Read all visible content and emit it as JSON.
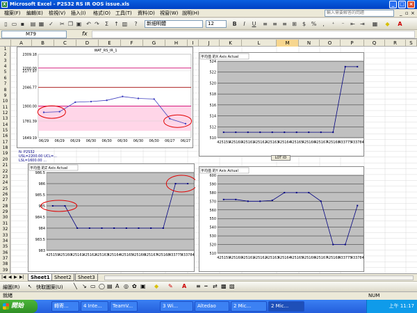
{
  "window": {
    "title": "Microsoft Excel - P2S32 RS IR OOS issue.xls"
  },
  "menu": {
    "items": [
      "檔案(F)",
      "編輯(E)",
      "檢視(V)",
      "插入(I)",
      "格式(O)",
      "工具(T)",
      "資料(D)",
      "視窗(W)",
      "說明(H)"
    ],
    "help_placeholder": "輸入需要解答的問題"
  },
  "toolbar": {
    "font_name": "新細明體",
    "font_size": "12",
    "zoom_symbol": "Σ",
    "percent": "%",
    "bold": "B",
    "italic": "I",
    "underline": "U"
  },
  "formula": {
    "name_box": "M79",
    "fx": "fx"
  },
  "columns": [
    "A",
    "B",
    "C",
    "D",
    "E",
    "F",
    "G",
    "H",
    "I",
    "J",
    "K",
    "L",
    "M",
    "N",
    "O",
    "P",
    "Q",
    "R",
    "S"
  ],
  "rows": [
    "1",
    "2",
    "3",
    "4",
    "5",
    "6",
    "7",
    "8",
    "9",
    "10",
    "11",
    "12",
    "13",
    "14",
    "15",
    "16",
    "17",
    "18",
    "19",
    "20",
    "21",
    "22",
    "23",
    "24",
    "25",
    "26",
    "27",
    "28",
    "29",
    "30",
    "31",
    "32",
    "33",
    "34",
    "35",
    "36",
    "37",
    "38",
    "39"
  ],
  "sheets": [
    "Sheet1",
    "Sheet2",
    "Sheet3"
  ],
  "drawbar": {
    "draw_label": "繪圖(R)",
    "autoshape_label": "快取圖案(U)"
  },
  "status": {
    "ready": "就緒",
    "num": "NUM"
  },
  "taskbar": {
    "start": "開始",
    "tasks": [
      "轉寄...",
      "4 Inte...",
      "TeamV...",
      "3 Wi...",
      "Altedao",
      "2 Mic...",
      "2 Mic..."
    ],
    "clock": "上午 11:17"
  },
  "chart_data": [
    {
      "type": "line",
      "title": "WAT_RS_IR_1",
      "y_ticks": [
        "2309.18",
        "2200.00",
        "2177.97",
        "2046.77",
        "1900.00",
        "1781.39",
        "1649.19"
      ],
      "x_ticks": [
        "06/29",
        "06/29",
        "06/29",
        "06/30",
        "06/30",
        "06/30",
        "06/30",
        "06/30",
        "06/27",
        "06/27"
      ],
      "values": [
        1850,
        1855,
        1930,
        1935,
        1945,
        1975,
        1960,
        1955,
        1800,
        1760
      ],
      "stats_lines": [
        "N: P2S32",
        "USL=2200.00   UCL=...",
        "LSL=1600.00   ..."
      ],
      "ylim": [
        1649.19,
        2309.18
      ]
    },
    {
      "type": "line",
      "title": "平均值 的X Axis Actual",
      "categories": [
        "425159",
        "425160",
        "425161",
        "425162",
        "425163",
        "425164",
        "425165",
        "425166",
        "425167",
        "425168",
        "433775",
        "433784"
      ],
      "values": [
        511,
        511,
        511,
        511,
        511,
        511,
        511,
        511,
        511,
        511,
        523,
        523
      ],
      "y_ticks": [
        "524",
        "522",
        "520",
        "518",
        "516",
        "514",
        "512",
        "510"
      ],
      "ylim": [
        510,
        524
      ],
      "xlabel": "LOT ID"
    },
    {
      "type": "line",
      "title": "平均值 的Z Axis Actual",
      "categories": [
        "425159",
        "425160",
        "425161",
        "425162",
        "425163",
        "425164",
        "425165",
        "425166",
        "425167",
        "425168",
        "433775",
        "433784"
      ],
      "values": [
        985,
        985,
        984,
        984,
        984,
        984,
        984,
        984,
        984,
        984,
        986,
        986
      ],
      "y_ticks": [
        "986.5",
        "986",
        "985.5",
        "985",
        "984.5",
        "984",
        "983.5",
        "983"
      ],
      "ylim": [
        983,
        986.5
      ]
    },
    {
      "type": "line",
      "title": "平均值 的Y Axis Actual",
      "categories": [
        "425159",
        "425160",
        "425161",
        "425162",
        "425163",
        "425164",
        "425165",
        "425166",
        "425167",
        "425168",
        "433775",
        "433784"
      ],
      "values": [
        572,
        572,
        570,
        570,
        571,
        580,
        580,
        580,
        570,
        520,
        520,
        565
      ],
      "y_ticks": [
        "600",
        "590",
        "580",
        "570",
        "560",
        "550",
        "540",
        "530",
        "520",
        "510"
      ],
      "ylim": [
        510,
        600
      ]
    }
  ]
}
